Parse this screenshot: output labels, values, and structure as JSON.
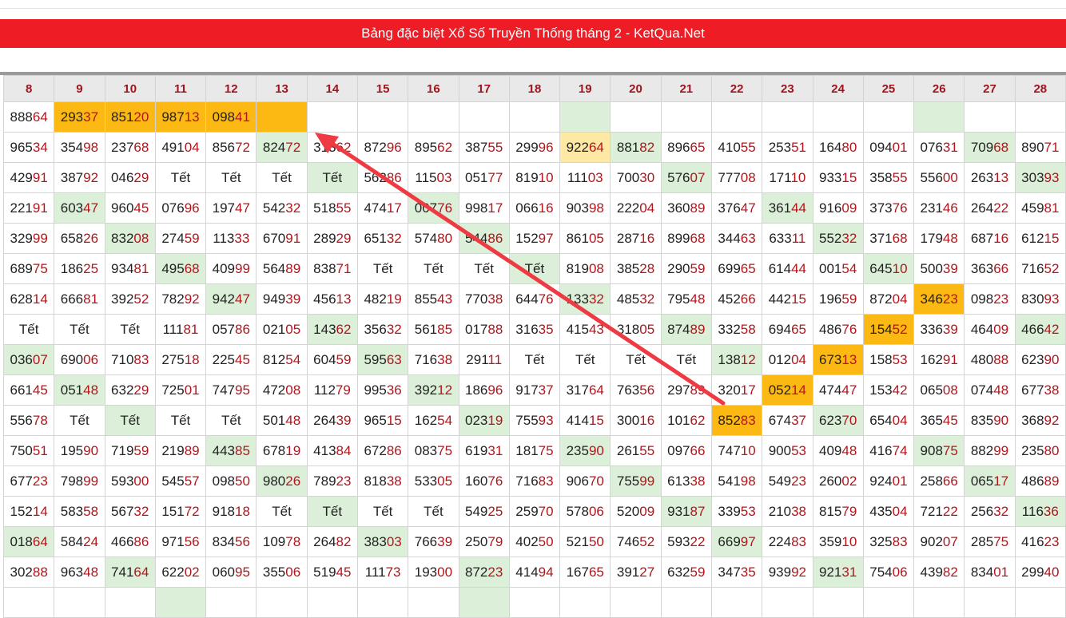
{
  "banner": {
    "title": "Bảng đặc biệt Xổ Số Truyền Thống tháng 2 - KetQua.Net"
  },
  "table": {
    "columns": [
      "8",
      "9",
      "10",
      "11",
      "12",
      "13",
      "14",
      "15",
      "16",
      "17",
      "18",
      "19",
      "20",
      "21",
      "22",
      "23",
      "24",
      "25",
      "26",
      "27",
      "28"
    ],
    "rows": [
      [
        [
          "88864",
          ""
        ],
        [
          "29337",
          "gold"
        ],
        [
          "85120",
          "gold"
        ],
        [
          "98713",
          "gold"
        ],
        [
          "09841",
          "gold"
        ],
        [
          "",
          "gold"
        ],
        [
          "",
          ""
        ],
        [
          "",
          ""
        ],
        [
          "",
          ""
        ],
        [
          "",
          ""
        ],
        [
          "",
          ""
        ],
        [
          "",
          "green"
        ],
        [
          "",
          ""
        ],
        [
          "",
          ""
        ],
        [
          "",
          ""
        ],
        [
          "",
          ""
        ],
        [
          "",
          ""
        ],
        [
          "",
          ""
        ],
        [
          "",
          "green"
        ],
        [
          "",
          ""
        ],
        [
          "",
          ""
        ]
      ],
      [
        [
          "96534",
          ""
        ],
        [
          "35498",
          ""
        ],
        [
          "23768",
          ""
        ],
        [
          "49104",
          ""
        ],
        [
          "85672",
          ""
        ],
        [
          "82472",
          "green"
        ],
        [
          "31362",
          ""
        ],
        [
          "87296",
          ""
        ],
        [
          "89562",
          ""
        ],
        [
          "38755",
          ""
        ],
        [
          "29996",
          ""
        ],
        [
          "92264",
          "light"
        ],
        [
          "88182",
          "green"
        ],
        [
          "89665",
          ""
        ],
        [
          "41055",
          ""
        ],
        [
          "25351",
          ""
        ],
        [
          "16480",
          ""
        ],
        [
          "09401",
          ""
        ],
        [
          "07631",
          ""
        ],
        [
          "70968",
          "green"
        ],
        [
          "89071",
          ""
        ]
      ],
      [
        [
          "42991",
          ""
        ],
        [
          "38792",
          ""
        ],
        [
          "04629",
          ""
        ],
        [
          "Tết",
          ""
        ],
        [
          "Tết",
          ""
        ],
        [
          "Tết",
          ""
        ],
        [
          "Tết",
          "green"
        ],
        [
          "56286",
          ""
        ],
        [
          "11503",
          ""
        ],
        [
          "05177",
          ""
        ],
        [
          "81910",
          ""
        ],
        [
          "11103",
          ""
        ],
        [
          "70030",
          ""
        ],
        [
          "57607",
          "green"
        ],
        [
          "77708",
          ""
        ],
        [
          "17110",
          ""
        ],
        [
          "93315",
          ""
        ],
        [
          "35855",
          ""
        ],
        [
          "55600",
          ""
        ],
        [
          "26313",
          ""
        ],
        [
          "30393",
          "green"
        ]
      ],
      [
        [
          "22191",
          ""
        ],
        [
          "60347",
          "green"
        ],
        [
          "96045",
          ""
        ],
        [
          "07696",
          ""
        ],
        [
          "19747",
          ""
        ],
        [
          "54232",
          ""
        ],
        [
          "51855",
          ""
        ],
        [
          "47417",
          ""
        ],
        [
          "00776",
          "green"
        ],
        [
          "99817",
          ""
        ],
        [
          "06616",
          ""
        ],
        [
          "90398",
          ""
        ],
        [
          "22204",
          ""
        ],
        [
          "36089",
          ""
        ],
        [
          "37647",
          ""
        ],
        [
          "36144",
          "green"
        ],
        [
          "91609",
          ""
        ],
        [
          "37376",
          ""
        ],
        [
          "23146",
          ""
        ],
        [
          "26422",
          ""
        ],
        [
          "45981",
          ""
        ]
      ],
      [
        [
          "32999",
          ""
        ],
        [
          "65826",
          ""
        ],
        [
          "83208",
          "green"
        ],
        [
          "27459",
          ""
        ],
        [
          "11333",
          ""
        ],
        [
          "67091",
          ""
        ],
        [
          "28929",
          ""
        ],
        [
          "65132",
          ""
        ],
        [
          "57480",
          ""
        ],
        [
          "54486",
          "green"
        ],
        [
          "15297",
          ""
        ],
        [
          "86105",
          ""
        ],
        [
          "28716",
          ""
        ],
        [
          "89968",
          ""
        ],
        [
          "34463",
          ""
        ],
        [
          "63311",
          ""
        ],
        [
          "55232",
          "green"
        ],
        [
          "37168",
          ""
        ],
        [
          "17948",
          ""
        ],
        [
          "68716",
          ""
        ],
        [
          "61215",
          ""
        ]
      ],
      [
        [
          "68975",
          ""
        ],
        [
          "18625",
          ""
        ],
        [
          "93481",
          ""
        ],
        [
          "49568",
          "green"
        ],
        [
          "40999",
          ""
        ],
        [
          "56489",
          ""
        ],
        [
          "83871",
          ""
        ],
        [
          "Tết",
          ""
        ],
        [
          "Tết",
          ""
        ],
        [
          "Tết",
          ""
        ],
        [
          "Tết",
          "green"
        ],
        [
          "81908",
          ""
        ],
        [
          "38528",
          ""
        ],
        [
          "29059",
          ""
        ],
        [
          "69965",
          ""
        ],
        [
          "61444",
          ""
        ],
        [
          "00154",
          ""
        ],
        [
          "64510",
          "green"
        ],
        [
          "50039",
          ""
        ],
        [
          "36366",
          ""
        ],
        [
          "71652",
          ""
        ]
      ],
      [
        [
          "62814",
          ""
        ],
        [
          "66681",
          ""
        ],
        [
          "39252",
          ""
        ],
        [
          "78292",
          ""
        ],
        [
          "94247",
          "green"
        ],
        [
          "94939",
          ""
        ],
        [
          "45613",
          ""
        ],
        [
          "48219",
          ""
        ],
        [
          "85543",
          ""
        ],
        [
          "77038",
          ""
        ],
        [
          "64476",
          ""
        ],
        [
          "13332",
          "green"
        ],
        [
          "48532",
          ""
        ],
        [
          "79548",
          ""
        ],
        [
          "45266",
          ""
        ],
        [
          "44215",
          ""
        ],
        [
          "19659",
          ""
        ],
        [
          "87204",
          ""
        ],
        [
          "34623",
          "gold"
        ],
        [
          "09823",
          ""
        ],
        [
          "83093",
          ""
        ]
      ],
      [
        [
          "Tết",
          ""
        ],
        [
          "Tết",
          ""
        ],
        [
          "Tết",
          ""
        ],
        [
          "11181",
          ""
        ],
        [
          "05786",
          ""
        ],
        [
          "02105",
          ""
        ],
        [
          "14362",
          "green"
        ],
        [
          "35632",
          ""
        ],
        [
          "56185",
          ""
        ],
        [
          "01788",
          ""
        ],
        [
          "31635",
          ""
        ],
        [
          "41543",
          ""
        ],
        [
          "31805",
          ""
        ],
        [
          "87489",
          "green"
        ],
        [
          "33258",
          ""
        ],
        [
          "69465",
          ""
        ],
        [
          "48676",
          ""
        ],
        [
          "15452",
          "gold"
        ],
        [
          "33639",
          ""
        ],
        [
          "46409",
          ""
        ],
        [
          "46642",
          "green"
        ]
      ],
      [
        [
          "03607",
          "green"
        ],
        [
          "69006",
          ""
        ],
        [
          "71083",
          ""
        ],
        [
          "27518",
          ""
        ],
        [
          "22545",
          ""
        ],
        [
          "81254",
          ""
        ],
        [
          "60459",
          ""
        ],
        [
          "59563",
          "green"
        ],
        [
          "71638",
          ""
        ],
        [
          "29111",
          ""
        ],
        [
          "Tết",
          ""
        ],
        [
          "Tết",
          ""
        ],
        [
          "Tết",
          ""
        ],
        [
          "Tết",
          ""
        ],
        [
          "13812",
          "green"
        ],
        [
          "01204",
          ""
        ],
        [
          "67313",
          "gold"
        ],
        [
          "15853",
          ""
        ],
        [
          "16291",
          ""
        ],
        [
          "48088",
          ""
        ],
        [
          "62390",
          ""
        ]
      ],
      [
        [
          "66145",
          ""
        ],
        [
          "05148",
          "green"
        ],
        [
          "63229",
          ""
        ],
        [
          "72501",
          ""
        ],
        [
          "74795",
          ""
        ],
        [
          "47208",
          ""
        ],
        [
          "11279",
          ""
        ],
        [
          "99536",
          ""
        ],
        [
          "39212",
          "green"
        ],
        [
          "18696",
          ""
        ],
        [
          "91737",
          ""
        ],
        [
          "31764",
          ""
        ],
        [
          "76356",
          ""
        ],
        [
          "29789",
          ""
        ],
        [
          "32017",
          ""
        ],
        [
          "05214",
          "gold"
        ],
        [
          "47447",
          ""
        ],
        [
          "15342",
          ""
        ],
        [
          "06508",
          ""
        ],
        [
          "07448",
          ""
        ],
        [
          "67738",
          ""
        ]
      ],
      [
        [
          "55678",
          ""
        ],
        [
          "Tết",
          ""
        ],
        [
          "Tết",
          "green"
        ],
        [
          "Tết",
          ""
        ],
        [
          "Tết",
          ""
        ],
        [
          "50148",
          ""
        ],
        [
          "26439",
          ""
        ],
        [
          "96515",
          ""
        ],
        [
          "16254",
          ""
        ],
        [
          "02319",
          "green"
        ],
        [
          "75593",
          ""
        ],
        [
          "41415",
          ""
        ],
        [
          "30016",
          ""
        ],
        [
          "10162",
          ""
        ],
        [
          "85283",
          "gold"
        ],
        [
          "67437",
          ""
        ],
        [
          "62370",
          "green"
        ],
        [
          "65404",
          ""
        ],
        [
          "36545",
          ""
        ],
        [
          "83590",
          ""
        ],
        [
          "36892",
          ""
        ]
      ],
      [
        [
          "75051",
          ""
        ],
        [
          "19590",
          ""
        ],
        [
          "71959",
          ""
        ],
        [
          "21989",
          ""
        ],
        [
          "44385",
          "green"
        ],
        [
          "67819",
          ""
        ],
        [
          "41384",
          ""
        ],
        [
          "67286",
          ""
        ],
        [
          "08375",
          ""
        ],
        [
          "61931",
          ""
        ],
        [
          "18175",
          ""
        ],
        [
          "23590",
          "green"
        ],
        [
          "26155",
          ""
        ],
        [
          "09766",
          ""
        ],
        [
          "74710",
          ""
        ],
        [
          "90053",
          ""
        ],
        [
          "40948",
          ""
        ],
        [
          "41674",
          ""
        ],
        [
          "90875",
          "green"
        ],
        [
          "88299",
          ""
        ],
        [
          "23580",
          ""
        ]
      ],
      [
        [
          "67723",
          ""
        ],
        [
          "79899",
          ""
        ],
        [
          "59300",
          ""
        ],
        [
          "54557",
          ""
        ],
        [
          "09850",
          ""
        ],
        [
          "98026",
          "green"
        ],
        [
          "78923",
          ""
        ],
        [
          "81838",
          ""
        ],
        [
          "53305",
          ""
        ],
        [
          "16076",
          ""
        ],
        [
          "71683",
          ""
        ],
        [
          "90670",
          ""
        ],
        [
          "75599",
          "green"
        ],
        [
          "61338",
          ""
        ],
        [
          "54198",
          ""
        ],
        [
          "54923",
          ""
        ],
        [
          "26002",
          ""
        ],
        [
          "92401",
          ""
        ],
        [
          "25866",
          ""
        ],
        [
          "06517",
          "green"
        ],
        [
          "48689",
          ""
        ]
      ],
      [
        [
          "15214",
          ""
        ],
        [
          "58358",
          ""
        ],
        [
          "56732",
          ""
        ],
        [
          "15172",
          ""
        ],
        [
          "91818",
          ""
        ],
        [
          "Tết",
          ""
        ],
        [
          "Tết",
          "green"
        ],
        [
          "Tết",
          ""
        ],
        [
          "Tết",
          ""
        ],
        [
          "54925",
          ""
        ],
        [
          "25970",
          ""
        ],
        [
          "57806",
          ""
        ],
        [
          "52009",
          ""
        ],
        [
          "93187",
          "green"
        ],
        [
          "33953",
          ""
        ],
        [
          "21038",
          ""
        ],
        [
          "81579",
          ""
        ],
        [
          "43504",
          ""
        ],
        [
          "72122",
          ""
        ],
        [
          "25632",
          ""
        ],
        [
          "11636",
          "green"
        ]
      ],
      [
        [
          "01864",
          "green"
        ],
        [
          "58424",
          ""
        ],
        [
          "46686",
          ""
        ],
        [
          "97156",
          ""
        ],
        [
          "83456",
          ""
        ],
        [
          "10978",
          ""
        ],
        [
          "26482",
          ""
        ],
        [
          "38303",
          "green"
        ],
        [
          "76639",
          ""
        ],
        [
          "25079",
          ""
        ],
        [
          "40250",
          ""
        ],
        [
          "52150",
          ""
        ],
        [
          "74652",
          ""
        ],
        [
          "59322",
          ""
        ],
        [
          "66997",
          "green"
        ],
        [
          "22483",
          ""
        ],
        [
          "35910",
          ""
        ],
        [
          "32583",
          ""
        ],
        [
          "90207",
          ""
        ],
        [
          "28575",
          ""
        ],
        [
          "41623",
          ""
        ]
      ],
      [
        [
          "30288",
          ""
        ],
        [
          "96348",
          ""
        ],
        [
          "74164",
          "green"
        ],
        [
          "62202",
          ""
        ],
        [
          "06095",
          ""
        ],
        [
          "35506",
          ""
        ],
        [
          "51945",
          ""
        ],
        [
          "11173",
          ""
        ],
        [
          "19300",
          ""
        ],
        [
          "87223",
          "green"
        ],
        [
          "41494",
          ""
        ],
        [
          "16765",
          ""
        ],
        [
          "39127",
          ""
        ],
        [
          "63259",
          ""
        ],
        [
          "34735",
          ""
        ],
        [
          "93992",
          ""
        ],
        [
          "92131",
          "green"
        ],
        [
          "75406",
          ""
        ],
        [
          "43982",
          ""
        ],
        [
          "83401",
          ""
        ],
        [
          "29940",
          ""
        ]
      ],
      [
        [
          "",
          ""
        ],
        [
          "",
          ""
        ],
        [
          "",
          ""
        ],
        [
          "",
          "green"
        ],
        [
          "",
          ""
        ],
        [
          "",
          ""
        ],
        [
          "",
          ""
        ],
        [
          "",
          ""
        ],
        [
          "",
          ""
        ],
        [
          "",
          "green"
        ],
        [
          "",
          ""
        ],
        [
          "",
          ""
        ],
        [
          "",
          ""
        ],
        [
          "",
          ""
        ],
        [
          "",
          ""
        ],
        [
          "",
          ""
        ],
        [
          "",
          ""
        ],
        [
          "",
          ""
        ],
        [
          "",
          ""
        ],
        [
          "",
          ""
        ],
        [
          "",
          ""
        ]
      ]
    ]
  },
  "colors": {
    "banner": "#ee1c25",
    "cell_green": "#dcf0d9",
    "cell_gold": "#fdb913",
    "cell_light_gold": "#fde9a3",
    "last_two_digits": "#b5141b",
    "arrow": "#ee3a43"
  },
  "annotation": {
    "icon": "arrow-icon"
  }
}
